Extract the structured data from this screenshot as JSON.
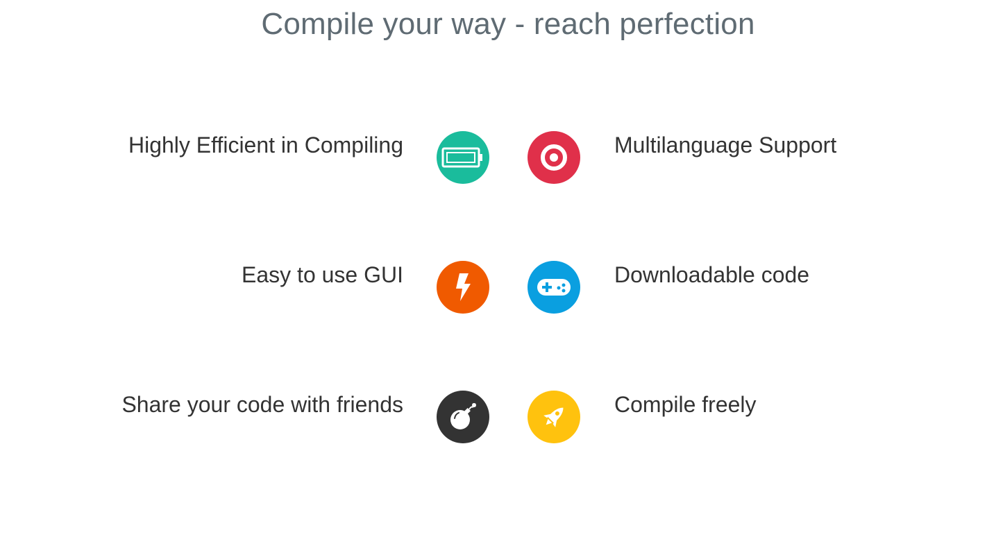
{
  "page": {
    "title": "Compile your way - reach perfection"
  },
  "features": {
    "left": [
      {
        "label": "Highly Efficient in Compiling",
        "icon": "battery-icon",
        "color": "#1ABC9C"
      },
      {
        "label": "Easy to use GUI",
        "icon": "lightning-bolt-icon",
        "color": "#F05A00"
      },
      {
        "label": "Share your code with friends",
        "icon": "bomb-icon",
        "color": "#333333"
      }
    ],
    "right": [
      {
        "label": "Multilanguage Support",
        "icon": "target-icon",
        "color": "#E0304A"
      },
      {
        "label": "Downloadable code",
        "icon": "gamepad-icon",
        "color": "#0A9FE0"
      },
      {
        "label": "Compile freely",
        "icon": "rocket-icon",
        "color": "#FFC20E"
      }
    ]
  }
}
